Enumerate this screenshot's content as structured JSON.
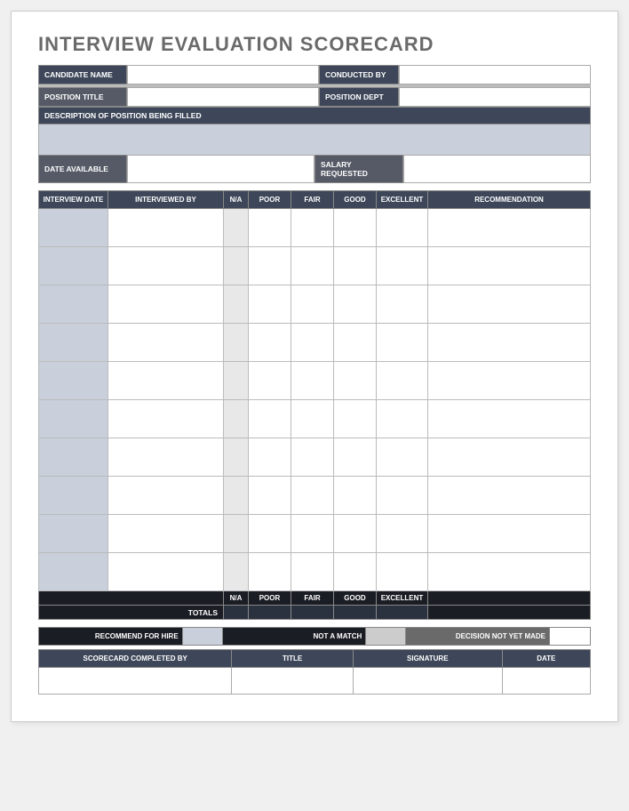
{
  "title": "INTERVIEW EVALUATION SCORECARD",
  "fields": {
    "candidate_name_label": "CANDIDATE NAME",
    "conducted_by_label": "CONDUCTED BY",
    "position_title_label": "POSITION TITLE",
    "position_dept_label": "POSITION DEPT",
    "description_label": "DESCRIPTION OF POSITION BEING FILLED",
    "date_available_label": "DATE AVAILABLE",
    "salary_requested_label": "SALARY REQUESTED"
  },
  "table_headers": {
    "interview_date": "INTERVIEW DATE",
    "interviewed_by": "INTERVIEWED BY",
    "na": "N/A",
    "poor": "POOR",
    "fair": "FAIR",
    "good": "GOOD",
    "excellent": "EXCELLENT",
    "recommendation": "RECOMMENDATION"
  },
  "footer_headers": {
    "na": "N/A",
    "poor": "POOR",
    "fair": "FAIR",
    "good": "GOOD",
    "excellent": "EXCELLENT"
  },
  "totals_label": "TOTALS",
  "decisions": {
    "recommend": "RECOMMEND FOR HIRE",
    "not_match": "NOT A MATCH",
    "not_yet": "DECISION NOT YET MADE"
  },
  "signoff_headers": {
    "completed_by": "SCORECARD COMPLETED BY",
    "title": "TITLE",
    "signature": "SIGNATURE",
    "date": "DATE"
  },
  "row_count": 10
}
